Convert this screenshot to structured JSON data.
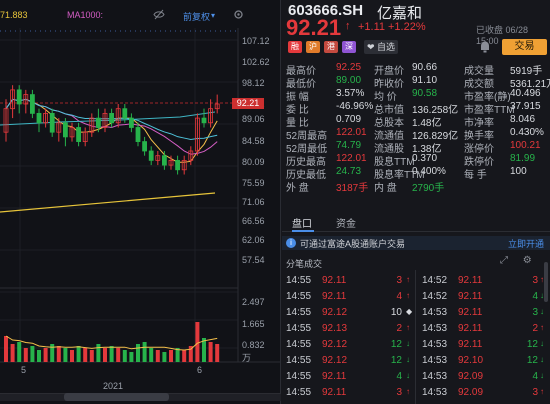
{
  "chart": {
    "ma5_label": "71.883",
    "ma1000_label": "MA1000:",
    "hide_icon": "eye-off-icon",
    "adjust_label": "前复权",
    "y_labels": [
      "107.12",
      "102.62",
      "98.12",
      "93.62",
      "89.06",
      "84.58",
      "80.09",
      "75.59",
      "71.06",
      "66.56",
      "62.06",
      "57.54",
      "2.497",
      "1.665",
      "0.832",
      "万"
    ],
    "last_price_label": "92.21",
    "x_labels": [
      "5",
      "6"
    ],
    "year_label": "2021",
    "candles": [
      {
        "o": 86,
        "c": 91,
        "h": 93,
        "l": 84
      },
      {
        "o": 91,
        "c": 95,
        "h": 96,
        "l": 89
      },
      {
        "o": 95,
        "c": 92,
        "h": 96,
        "l": 90
      },
      {
        "o": 92,
        "c": 94,
        "h": 95,
        "l": 90
      },
      {
        "o": 94,
        "c": 90,
        "h": 95,
        "l": 89
      },
      {
        "o": 90,
        "c": 88,
        "h": 91,
        "l": 86
      },
      {
        "o": 88,
        "c": 90,
        "h": 91,
        "l": 87
      },
      {
        "o": 90,
        "c": 86,
        "h": 91,
        "l": 85
      },
      {
        "o": 86,
        "c": 88,
        "h": 89,
        "l": 84
      },
      {
        "o": 88,
        "c": 85,
        "h": 89,
        "l": 83
      },
      {
        "o": 85,
        "c": 87,
        "h": 88,
        "l": 84
      },
      {
        "o": 87,
        "c": 84,
        "h": 88,
        "l": 83
      },
      {
        "o": 84,
        "c": 86,
        "h": 87,
        "l": 83
      },
      {
        "o": 86,
        "c": 89,
        "h": 90,
        "l": 85
      },
      {
        "o": 89,
        "c": 87,
        "h": 91,
        "l": 86
      },
      {
        "o": 87,
        "c": 90,
        "h": 91,
        "l": 86
      },
      {
        "o": 90,
        "c": 88,
        "h": 91,
        "l": 87
      },
      {
        "o": 88,
        "c": 91,
        "h": 92,
        "l": 87
      },
      {
        "o": 91,
        "c": 89,
        "h": 92,
        "l": 88
      },
      {
        "o": 89,
        "c": 87,
        "h": 90,
        "l": 86
      },
      {
        "o": 87,
        "c": 84,
        "h": 88,
        "l": 83
      },
      {
        "o": 84,
        "c": 82,
        "h": 85,
        "l": 81
      },
      {
        "o": 82,
        "c": 80,
        "h": 83,
        "l": 79
      },
      {
        "o": 80,
        "c": 81,
        "h": 82,
        "l": 79
      },
      {
        "o": 81,
        "c": 79,
        "h": 82,
        "l": 78
      },
      {
        "o": 79,
        "c": 80,
        "h": 81,
        "l": 78
      },
      {
        "o": 80,
        "c": 78,
        "h": 81,
        "l": 77
      },
      {
        "o": 78,
        "c": 80,
        "h": 81,
        "l": 77
      },
      {
        "o": 80,
        "c": 82,
        "h": 83,
        "l": 79
      },
      {
        "o": 82,
        "c": 89,
        "h": 90,
        "l": 81
      },
      {
        "o": 89,
        "c": 88,
        "h": 91,
        "l": 87
      },
      {
        "o": 88,
        "c": 91,
        "h": 93,
        "l": 87
      },
      {
        "o": 91,
        "c": 92,
        "h": 94,
        "l": 90
      }
    ],
    "vol": [
      1.3,
      0.9,
      1.0,
      0.7,
      0.8,
      0.6,
      0.7,
      0.9,
      0.8,
      0.7,
      0.6,
      0.8,
      0.7,
      0.6,
      0.9,
      0.7,
      0.8,
      0.7,
      0.6,
      0.5,
      0.9,
      1.0,
      0.7,
      0.6,
      0.5,
      0.6,
      0.7,
      0.6,
      0.8,
      2.0,
      1.2,
      1.0,
      0.9
    ]
  },
  "quote": {
    "code": "603666.SH",
    "name": "亿嘉和",
    "price": "92.21",
    "arrow": "↑",
    "change": "+1.11",
    "change_pct": "+1.22%",
    "closed": "已收盘 06/28 15:00",
    "tags": [
      {
        "t": "融",
        "c": "#e4393c"
      },
      {
        "t": "沪",
        "c": "#e07b2a"
      },
      {
        "t": "港",
        "c": "#c44a3f"
      },
      {
        "t": "深",
        "c": "#8f54d3"
      }
    ],
    "fav_label": "❤ 自选",
    "trade_label": "交易"
  },
  "stats": [
    [
      {
        "l": "最高价",
        "v": "92.25",
        "c": "red"
      },
      {
        "l": "开盘价",
        "v": "90.66",
        "c": "wht"
      },
      {
        "l": "成交量",
        "v": "5919手",
        "c": "wht"
      }
    ],
    [
      {
        "l": "最低价",
        "v": "89.00",
        "c": "green"
      },
      {
        "l": "昨收价",
        "v": "91.10",
        "c": "wht"
      },
      {
        "l": "成交额",
        "v": "5361.21万",
        "c": "wht"
      }
    ],
    [
      {
        "l": "振    幅",
        "v": "3.57%",
        "c": "wht"
      },
      {
        "l": "均    价",
        "v": "90.58",
        "c": "green"
      },
      {
        "l": "市盈率(静)",
        "v": "40.496",
        "c": "wht"
      }
    ],
    [
      {
        "l": "委    比",
        "v": "-46.96%",
        "c": "wht"
      },
      {
        "l": "总市值",
        "v": "136.258亿",
        "c": "wht"
      },
      {
        "l": "市盈率TTM",
        "v": "37.915",
        "c": "wht"
      }
    ],
    [
      {
        "l": "量    比",
        "v": "0.709",
        "c": "wht"
      },
      {
        "l": "总股本",
        "v": "1.48亿",
        "c": "wht"
      },
      {
        "l": "市净率",
        "v": "8.046",
        "c": "wht"
      }
    ],
    [
      {
        "l": "52周最高",
        "v": "122.01",
        "c": "red"
      },
      {
        "l": "流通值",
        "v": "126.829亿",
        "c": "wht"
      },
      {
        "l": "换手率",
        "v": "0.430%",
        "c": "wht"
      }
    ],
    [
      {
        "l": "52周最低",
        "v": "74.79",
        "c": "green"
      },
      {
        "l": "流通股",
        "v": "1.38亿",
        "c": "wht"
      },
      {
        "l": "涨停价",
        "v": "100.21",
        "c": "red"
      }
    ],
    [
      {
        "l": "历史最高",
        "v": "122.01",
        "c": "red"
      },
      {
        "l": "股息TTM",
        "v": "0.370",
        "c": "wht"
      },
      {
        "l": "跌停价",
        "v": "81.99",
        "c": "green"
      }
    ],
    [
      {
        "l": "历史最低",
        "v": "24.73",
        "c": "green"
      },
      {
        "l": "股息率TTM",
        "v": "0.400%",
        "c": "wht"
      },
      {
        "l": "每    手",
        "v": "100",
        "c": "wht"
      }
    ],
    [
      {
        "l": "外    盘",
        "v": "3187手",
        "c": "red"
      },
      {
        "l": "内    盘",
        "v": "2790手",
        "c": "green"
      },
      {
        "l": "",
        "v": "",
        "c": "wht"
      }
    ]
  ],
  "tabs": {
    "tab1": "盘口",
    "tab2": "资金"
  },
  "notice": {
    "text": "可通过富途A股通账户交易",
    "open": "立即开通"
  },
  "ticks_header": "分笔成交",
  "ticks": [
    {
      "lt": "14:55",
      "lp": "92.11",
      "lv": "3",
      "ld": "up",
      "rt": "14:52",
      "rp": "92.11",
      "rv": "3",
      "rd": "up"
    },
    {
      "lt": "14:55",
      "lp": "92.11",
      "lv": "4",
      "ld": "up",
      "rt": "14:52",
      "rp": "92.11",
      "rv": "4",
      "rd": "dn"
    },
    {
      "lt": "14:55",
      "lp": "92.12",
      "lv": "10",
      "ld": "dot",
      "rt": "14:53",
      "rp": "92.11",
      "rv": "3",
      "rd": "dn"
    },
    {
      "lt": "14:55",
      "lp": "92.13",
      "lv": "2",
      "ld": "up",
      "rt": "14:53",
      "rp": "92.11",
      "rv": "2",
      "rd": "up"
    },
    {
      "lt": "14:55",
      "lp": "92.12",
      "lv": "12",
      "ld": "dn",
      "rt": "14:53",
      "rp": "92.11",
      "rv": "12",
      "rd": "dn"
    },
    {
      "lt": "14:55",
      "lp": "92.12",
      "lv": "12",
      "ld": "dn",
      "rt": "14:53",
      "rp": "92.10",
      "rv": "12",
      "rd": "dn"
    },
    {
      "lt": "14:55",
      "lp": "92.11",
      "lv": "4",
      "ld": "dn",
      "rt": "14:53",
      "rp": "92.09",
      "rv": "4",
      "rd": "dn"
    },
    {
      "lt": "14:55",
      "lp": "92.11",
      "lv": "3",
      "ld": "up",
      "rt": "14:53",
      "rp": "92.09",
      "rv": "3",
      "rd": "up"
    }
  ]
}
